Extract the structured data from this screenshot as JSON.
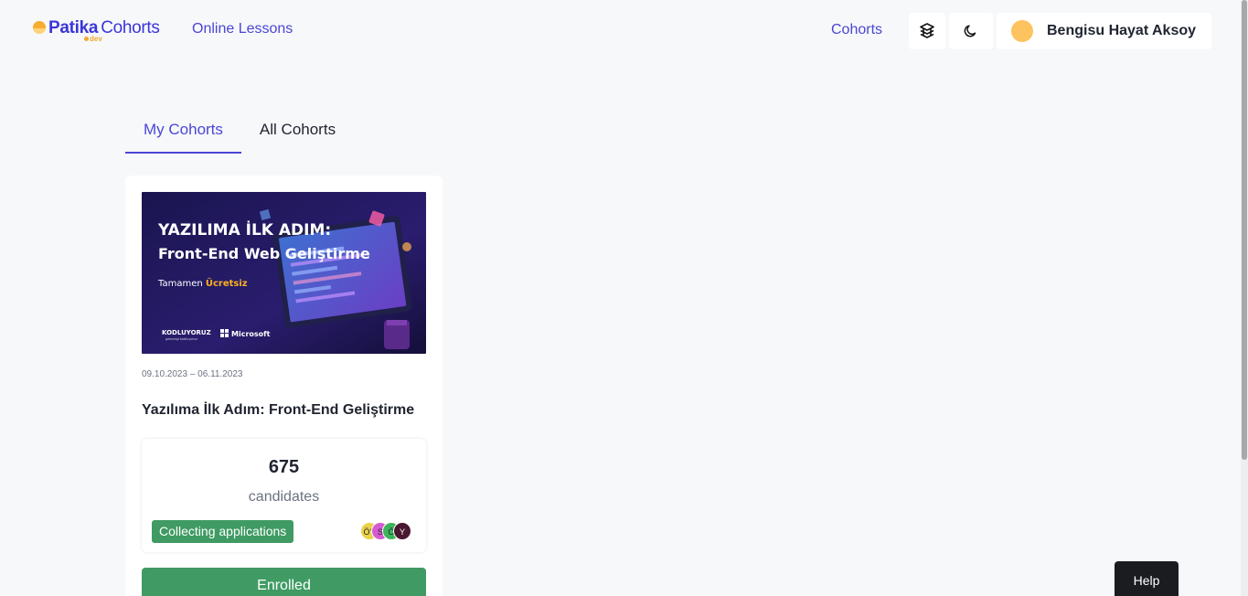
{
  "header": {
    "logo_patika": "Patika",
    "logo_cohorts": "Cohorts",
    "logo_dev": "dev",
    "nav_online_lessons": "Online Lessons",
    "nav_cohorts": "Cohorts",
    "layers_icon": "stack-layers-icon",
    "moon_icon": "moon-icon",
    "user_name": "Bengisu Hayat Aksoy"
  },
  "tabs": [
    {
      "label": "My Cohorts",
      "active": true
    },
    {
      "label": "All Cohorts",
      "active": false
    }
  ],
  "card": {
    "banner": {
      "line1": "YAZILIMA İLK ADIM:",
      "line2": "Front-End Web Geliştirme",
      "line3_prefix": "Tamamen ",
      "line3_highlight": "Ücretsiz",
      "brand1": "KODLUYORUZ",
      "brand1_sub": "gelecegi.kodluyoruz",
      "brand2": "Microsoft"
    },
    "dates": "09.10.2023 – 06.11.2023",
    "title": "Yazılıma İlk Adım: Front-End Geliştirme",
    "candidates_count": "675",
    "candidates_label": "candidates",
    "status": "Collecting applications",
    "avatars": [
      {
        "initials": "ÖY",
        "color": "#e9d24a"
      },
      {
        "initials": "S",
        "color": "#d65ad1"
      },
      {
        "initials": "Ö",
        "color": "#3cb45a"
      },
      {
        "initials": "Y",
        "color": "#4a1830"
      }
    ],
    "button_label": "Enrolled"
  },
  "help_label": "Help",
  "colors": {
    "brand": "#4a46d6",
    "success": "#3f9b63",
    "background": "#f7f8fa"
  }
}
